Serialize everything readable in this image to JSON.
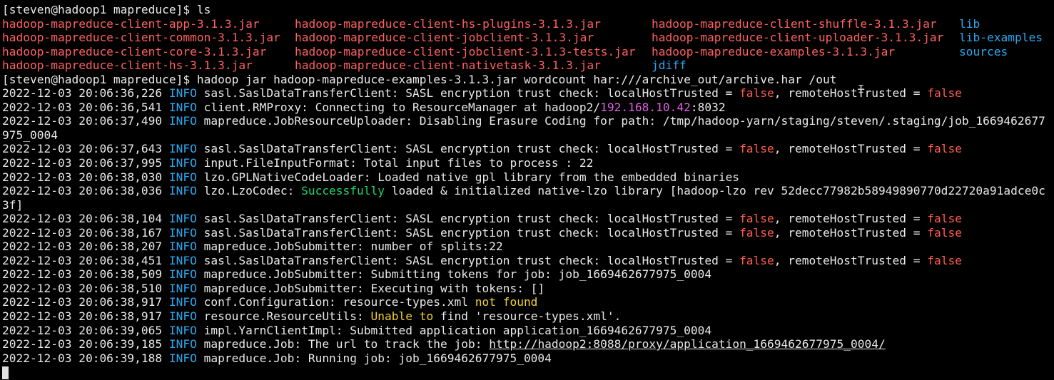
{
  "prompt1": "[steven@hadoop1 mapreduce]$ ls",
  "ls": [
    [
      "hadoop-mapreduce-client-app-3.1.3.jar",
      "hadoop-mapreduce-client-hs-plugins-3.1.3.jar",
      "hadoop-mapreduce-client-shuffle-3.1.3.jar",
      "lib"
    ],
    [
      "hadoop-mapreduce-client-common-3.1.3.jar",
      "hadoop-mapreduce-client-jobclient-3.1.3.jar",
      "hadoop-mapreduce-client-uploader-3.1.3.jar",
      "lib-examples"
    ],
    [
      "hadoop-mapreduce-client-core-3.1.3.jar",
      "hadoop-mapreduce-client-jobclient-3.1.3-tests.jar",
      "hadoop-mapreduce-examples-3.1.3.jar",
      "sources"
    ],
    [
      "hadoop-mapreduce-client-hs-3.1.3.jar",
      "hadoop-mapreduce-client-nativetask-3.1.3.jar",
      "jdiff"
    ]
  ],
  "prompt2": "[steven@hadoop1 mapreduce]$ hadoop jar hadoop-mapreduce-examples-3.1.3.jar wordcount har:///archive_out/archive.har /out",
  "level": "INFO",
  "false_word": "false",
  "log": {
    "l1_ts": "2022-12-03 20:06:36,226",
    "l1_a": " sasl.SaslDataTransferClient: SASL encryption trust check: localHostTrusted = ",
    "l1_b": ", remoteHostTrusted = ",
    "l2_ts": "2022-12-03 20:06:36,541",
    "l2_a": " client.RMProxy: Connecting to ResourceManager at hadoop2/",
    "l2_ip": "192.168.10.42",
    "l2_b": ":8032",
    "l3_ts": "2022-12-03 20:06:37,490",
    "l3_a": " mapreduce.JobResourceUploader: Disabling Erasure Coding for path: /tmp/hadoop-yarn/staging/steven/.staging/job_1669462677",
    "l3_wrap": "975_0004",
    "l4_ts": "2022-12-03 20:06:37,643",
    "l4_a": " sasl.SaslDataTransferClient: SASL encryption trust check: localHostTrusted = ",
    "l4_b": ", remoteHostTrusted = ",
    "l5_ts": "2022-12-03 20:06:37,995",
    "l5_a": " input.FileInputFormat: Total input files to process : 22",
    "l6_ts": "2022-12-03 20:06:38,030",
    "l6_a": " lzo.GPLNativeCodeLoader: Loaded native gpl library from the embedded binaries",
    "l7_ts": "2022-12-03 20:06:38,036",
    "l7_a": " lzo.LzoCodec: ",
    "l7_ok": "Successfully",
    "l7_b": " loaded & initialized native-lzo library [hadoop-lzo rev 52decc77982b58949890770d22720a91adce0c",
    "l7_wrap": "3f]",
    "l8_ts": "2022-12-03 20:06:38,104",
    "l8_a": " sasl.SaslDataTransferClient: SASL encryption trust check: localHostTrusted = ",
    "l8_b": ", remoteHostTrusted = ",
    "l9_ts": "2022-12-03 20:06:38,167",
    "l9_a": " sasl.SaslDataTransferClient: SASL encryption trust check: localHostTrusted = ",
    "l9_b": ", remoteHostTrusted = ",
    "l10_ts": "2022-12-03 20:06:38,207",
    "l10_a": " mapreduce.JobSubmitter: number of splits:22",
    "l11_ts": "2022-12-03 20:06:38,451",
    "l11_a": " sasl.SaslDataTransferClient: SASL encryption trust check: localHostTrusted = ",
    "l11_b": ", remoteHostTrusted = ",
    "l12_ts": "2022-12-03 20:06:38,509",
    "l12_a": " mapreduce.JobSubmitter: Submitting tokens for job: job_1669462677975_0004",
    "l13_ts": "2022-12-03 20:06:38,510",
    "l13_a": " mapreduce.JobSubmitter: Executing with tokens: []",
    "l14_ts": "2022-12-03 20:06:38,917",
    "l14_a": " conf.Configuration: resource-types.xml ",
    "l14_warn": "not found",
    "l15_ts": "2022-12-03 20:06:38,917",
    "l15_a": " resource.ResourceUtils: ",
    "l15_warn": "Unable to",
    "l15_b": " find 'resource-types.xml'.",
    "l16_ts": "2022-12-03 20:06:39,065",
    "l16_a": " impl.YarnClientImpl: Submitted application application_1669462677975_0004",
    "l17_ts": "2022-12-03 20:06:39,185",
    "l17_a": " mapreduce.Job: The url to track the job: ",
    "l17_url": "http://hadoop2:8088/proxy/application_1669462677975_0004/",
    "l18_ts": "2022-12-03 20:06:39,188",
    "l18_a": " mapreduce.Job: Running job: job_1669462677975_0004"
  },
  "colors": {
    "background": "#000000",
    "text": "#e8e8e8",
    "jar": "#ff6060",
    "dir": "#2aa7f0",
    "info": "#2aa7f0",
    "false": "#ff5a4f",
    "ip": "#e060e0",
    "success": "#21d66a",
    "warn": "#f2d033"
  }
}
